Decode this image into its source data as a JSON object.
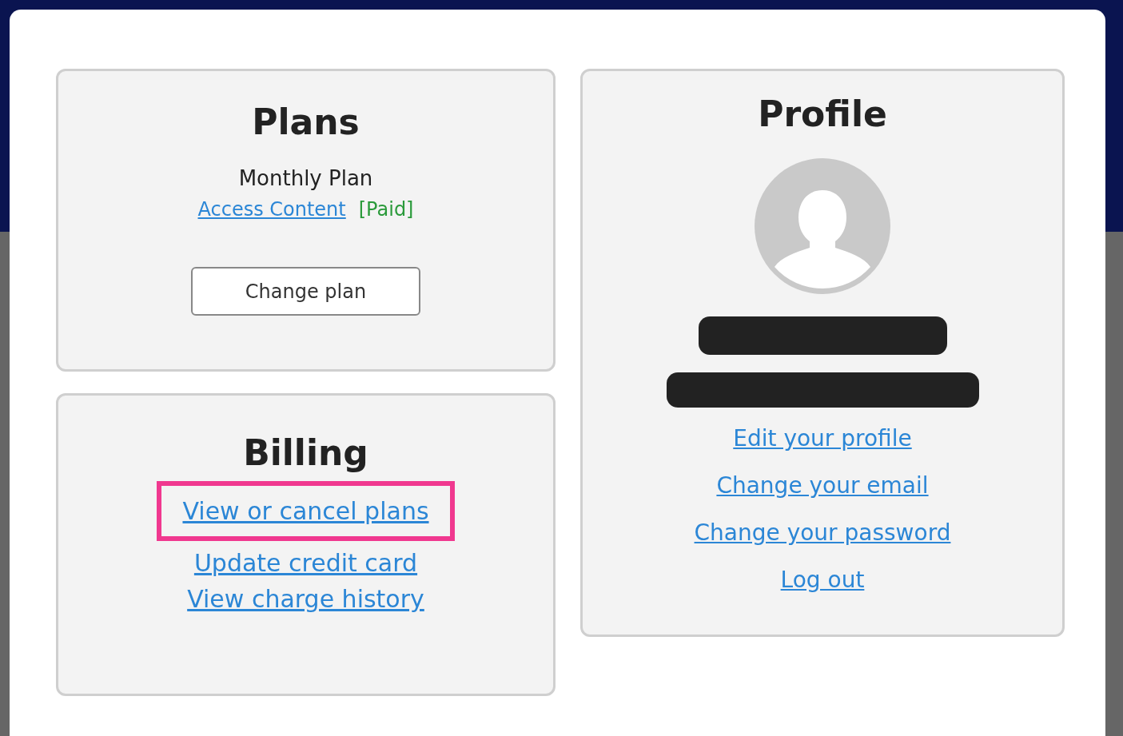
{
  "plans": {
    "title": "Plans",
    "plan_name": "Monthly Plan",
    "link": "Access Content",
    "status": "[Paid]",
    "button": "Change plan"
  },
  "billing": {
    "title": "Billing",
    "links": [
      {
        "label": "View or cancel plans",
        "highlighted": true
      },
      {
        "label": "Update credit card",
        "highlighted": false
      },
      {
        "label": "View charge history",
        "highlighted": false
      }
    ]
  },
  "profile": {
    "title": "Profile",
    "links": [
      "Edit your profile",
      "Change your email",
      "Change your password",
      "Log out"
    ]
  }
}
